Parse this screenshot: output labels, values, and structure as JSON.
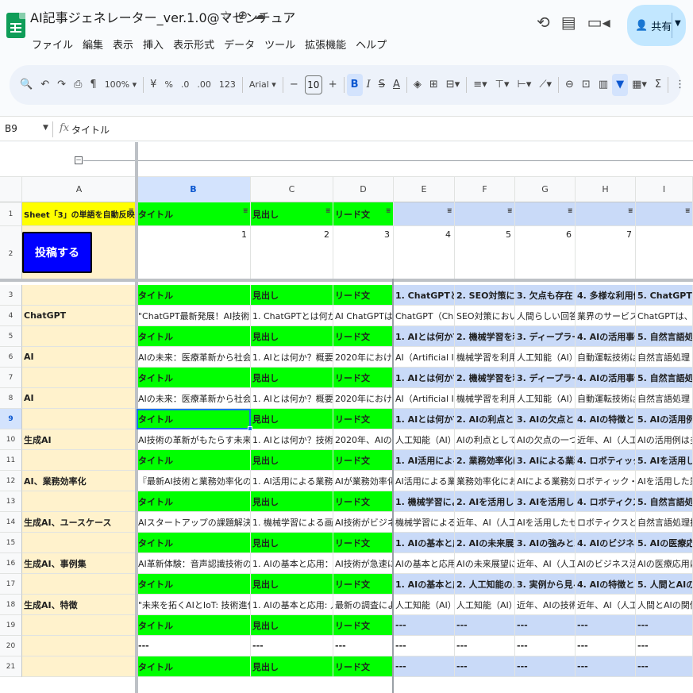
{
  "app": {
    "title": "AI記事ジェネレーター_ver.1.0@マゼンチュア",
    "title_icons": [
      "star-icon",
      "move-to-folder-icon",
      "cloud-status-icon"
    ],
    "menu": [
      "ファイル",
      "編集",
      "表示",
      "挿入",
      "表示形式",
      "データ",
      "ツール",
      "拡張機能",
      "ヘルプ"
    ],
    "share_label": "共有"
  },
  "toolbar": {
    "zoom": "100%",
    "currency": "¥",
    "percent": "%",
    "dec_decrease": ".0",
    "dec_increase": ".00",
    "number_format": "123",
    "font": "Arial",
    "font_size": "10",
    "bold": "B",
    "italic": "I",
    "strike": "S",
    "text_color": "A"
  },
  "formula_bar": {
    "cell_ref": "B9",
    "value": "タイトル"
  },
  "columns": [
    {
      "key": "A",
      "label": "A"
    },
    {
      "key": "B",
      "label": "B"
    },
    {
      "key": "C",
      "label": "C"
    },
    {
      "key": "D",
      "label": "D"
    },
    {
      "key": "E",
      "label": "E"
    },
    {
      "key": "F",
      "label": "F"
    },
    {
      "key": "G",
      "label": "G"
    },
    {
      "key": "H",
      "label": "H"
    },
    {
      "key": "I",
      "label": "I"
    }
  ],
  "row1": {
    "num": "1",
    "a": "Sheet「3」の単語を自動反映",
    "b": "タイトル",
    "c": "見出し",
    "d": "リード文"
  },
  "row2": {
    "num": "2",
    "button": "投稿する",
    "values": [
      "1",
      "2",
      "3",
      "4",
      "5",
      "6",
      "7"
    ]
  },
  "rows": [
    {
      "num": "3",
      "type": "header",
      "a": "",
      "b": "タイトル",
      "c": "見出し",
      "d": "リード文",
      "e": "1. ChatGPTとは何",
      "f": "2. SEO対策に有効",
      "g": "3. 欠点も存在",
      "h": "4. 多様な利用例",
      "i": "5. ChatGPTの"
    },
    {
      "num": "4",
      "type": "data",
      "a": "ChatGPT",
      "b": "\"ChatGPT最新発展！AI技術の革新が",
      "c": "1. ChatGPTとは何か？",
      "d": "AI ChatGPTは、GPT",
      "e": "ChatGPT（Chat G",
      "f": "SEO対策において、",
      "g": "人間らしい回答が",
      "h": "業界のサービスは、",
      "i": "ChatGPTは、多"
    },
    {
      "num": "5",
      "type": "header",
      "a": "",
      "b": "タイトル",
      "c": "見出し",
      "d": "リード文",
      "e": "1. AIとは何か？概要",
      "f": "2. 機械学習を利用し",
      "g": "3. ディープラーニン",
      "h": "4. AIの活用事例：自",
      "i": "5. 自然言語処理"
    },
    {
      "num": "6",
      "type": "data",
      "a": "AI",
      "b": "AIの未来：医療革新から社会変革へ",
      "c": "1. AIとは何か？概要と特徴",
      "d": "2020年におけるAI",
      "e": "AI（Artificial Intellig",
      "f": "機械学習を利用した",
      "g": "人工知能（AI）の急",
      "h": "自動運転技術は、人",
      "i": "自然言語処理（"
    },
    {
      "num": "7",
      "type": "header",
      "a": "",
      "b": "タイトル",
      "c": "見出し",
      "d": "リード文",
      "e": "1. AIとは何か？概要",
      "f": "2. 機械学習を利用し",
      "g": "3. ディープラーニン",
      "h": "4. AIの活用事例：自",
      "i": "5. 自然言語処理"
    },
    {
      "num": "8",
      "type": "data",
      "a": "AI",
      "b": "AIの未来：医療革新から社会変革へ",
      "c": "1. AIとは何か？概要と特徴",
      "d": "2020年におけるAI",
      "e": "AI（Artificial Intellig",
      "f": "機械学習を利用した",
      "g": "人工知能（AI）の急",
      "h": "自動運転技術は、人",
      "i": "自然言語処理（"
    },
    {
      "num": "9",
      "type": "header",
      "a": "",
      "b": "タイトル",
      "c": "見出し",
      "d": "リード文",
      "e": "1. AIとは何か？技術",
      "f": "2. AIの利点としては",
      "g": "3. AIの欠点としては",
      "h": "4. AIの特徴としては",
      "i": "5. AIの活用例と"
    },
    {
      "num": "10",
      "type": "data",
      "a": "生成AI",
      "b": "AI技術の革新がもたらす未来の可能",
      "c": "1. AIとは何か？技術の進化",
      "d": "2020年、AIの進化は",
      "e": "人工知能（AI）とは",
      "f": "AIの利点としては、",
      "g": "AIの欠点の一つとし",
      "h": "近年、AI（人工知能",
      "i": "AIの活用例は多"
    },
    {
      "num": "11",
      "type": "header",
      "a": "",
      "b": "タイトル",
      "c": "見出し",
      "d": "リード文",
      "e": "1. AI活用による業務",
      "f": "2. 業務効率化におけ",
      "g": "3. AIによる業務効率",
      "h": "4. ロボティック・プ",
      "i": "5. AIを活用した"
    },
    {
      "num": "12",
      "type": "data",
      "a": "AI、業務効率化",
      "b": "『最新AI技術と業務効率化の課題解",
      "c": "1. AI活用による業務効率化",
      "d": "AIが業務効率化に与",
      "e": "AI活用による業務効",
      "f": "業務効率化における",
      "g": "AIによる業務効率化",
      "h": "ロボティック・プロ",
      "i": "AIを活用した業"
    },
    {
      "num": "13",
      "type": "header",
      "a": "",
      "b": "タイトル",
      "c": "見出し",
      "d": "リード文",
      "e": "1. 機械学習による画",
      "f": "2. AIを活用した顧客",
      "g": "3. AIを活用した顧客",
      "h": "4. ロボティクスとAI",
      "i": "5. 自然言語処理"
    },
    {
      "num": "14",
      "type": "data",
      "a": "生成AI、ユースケース",
      "b": "AIスタートアップの課題解決法と成功",
      "c": "1. 機械学習による画像認識",
      "d": "AI技術がビジネスに",
      "e": "機械学習による画像",
      "f": "近年、AI（人工知能",
      "g": "AIを活用したセキュ",
      "h": "ロボティクスと人工",
      "i": "自然言語処理技"
    },
    {
      "num": "15",
      "type": "header",
      "a": "",
      "b": "タイトル",
      "c": "見出し",
      "d": "リード文",
      "e": "1. AIの基本と応用：",
      "f": "2. AIの未来展望：革",
      "g": "3. AIの強みと弱み：",
      "h": "4. AIのビジネス活用",
      "i": "5. AIの医療応用"
    },
    {
      "num": "16",
      "type": "data",
      "a": "生成AI、事例集",
      "b": "AI革新体験：音声認識技術の最新ト",
      "c": "1. AIの基本と応用：機械学",
      "d": "AI技術が急速に進化",
      "e": "AIの基本と応用につ",
      "f": "AIの未来展望につい",
      "g": "近年、AI（人工知能",
      "h": "AIのビジネス活用に",
      "i": "AIの医療応用は"
    },
    {
      "num": "17",
      "type": "header",
      "a": "",
      "b": "タイトル",
      "c": "見出し",
      "d": "リード文",
      "e": "1. AIの基本と応用：",
      "f": "2. 人工知能のメリッ",
      "g": "3. 実例から見るAIの",
      "h": "4. AIの特徴とは何か",
      "i": "5. 人間とAIの関"
    },
    {
      "num": "18",
      "type": "data",
      "a": "生成AI、特徴",
      "b": "\"未来を拓くAIとIoT: 技術進化の最新",
      "c": "1. AIの基本と応用: 人工知能",
      "d": "最新の調査によると",
      "e": "人工知能（AI）は、",
      "f": "人工知能（AI）は、",
      "g": "近年、AIの技術が急",
      "h": "近年、AI（人工知能",
      "i": "人間とAIの関係"
    },
    {
      "num": "19",
      "type": "header",
      "a": "",
      "b": "タイトル",
      "c": "見出し",
      "d": "リード文",
      "e": "---",
      "f": "---",
      "g": "---",
      "h": "---",
      "i": "---"
    },
    {
      "num": "20",
      "type": "blank",
      "a": "",
      "b": "---",
      "c": "---",
      "d": "---",
      "e": "---",
      "f": "---",
      "g": "---",
      "h": "---",
      "i": "---"
    },
    {
      "num": "21",
      "type": "header",
      "a": "",
      "b": "タイトル",
      "c": "見出し",
      "d": "リード文",
      "e": "---",
      "f": "---",
      "g": "---",
      "h": "---",
      "i": "---"
    }
  ],
  "colors": {
    "green": "#00ff00",
    "blue_header": "#c9daf8",
    "col_a": "#fff2cc",
    "yellow": "#ffff00",
    "button": "#0000ff",
    "selection": "#1a73e8"
  }
}
